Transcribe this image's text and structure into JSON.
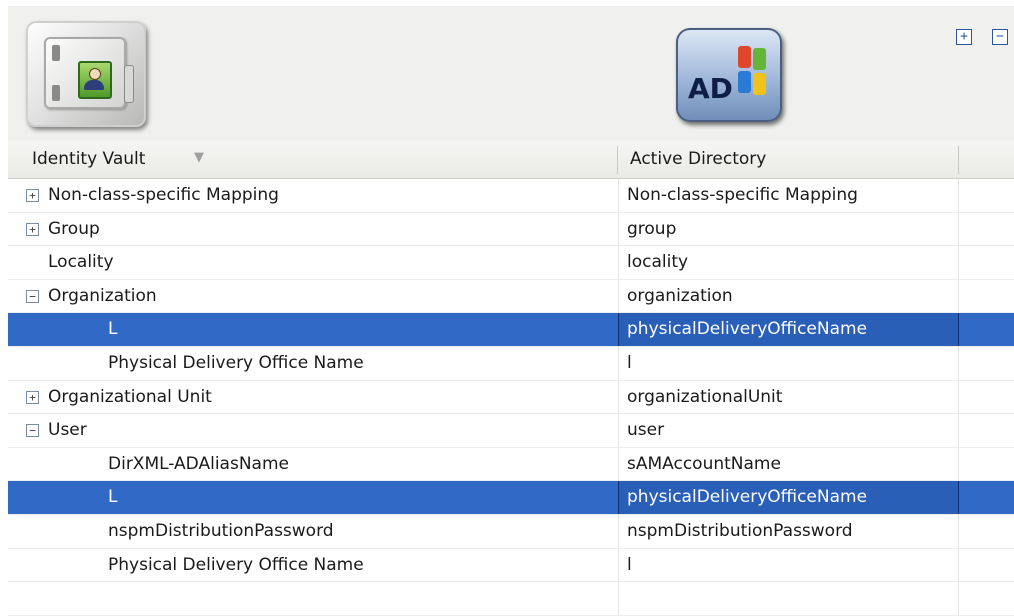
{
  "toolbar": {
    "expand_all_glyph": "+",
    "collapse_all_glyph": "−"
  },
  "icons": {
    "left": "identity-vault-icon",
    "right": "active-directory-icon",
    "right_label": "AD"
  },
  "columns": {
    "left_header": "Identity Vault",
    "right_header": "Active Directory",
    "sort_indicator": "▼"
  },
  "rows": [
    {
      "left": "Non-class-specific Mapping",
      "right": "Non-class-specific Mapping",
      "level": 0,
      "toggle": "+",
      "selected": false
    },
    {
      "left": "Group",
      "right": "group",
      "level": 0,
      "toggle": "+",
      "selected": false
    },
    {
      "left": "Locality",
      "right": "locality",
      "level": 0,
      "toggle": "",
      "selected": false
    },
    {
      "left": "Organization",
      "right": "organization",
      "level": 0,
      "toggle": "−",
      "selected": false
    },
    {
      "left": "L",
      "right": "physicalDeliveryOfficeName",
      "level": 1,
      "toggle": "",
      "selected": true
    },
    {
      "left": "Physical Delivery Office Name",
      "right": "l",
      "level": 1,
      "toggle": "",
      "selected": false
    },
    {
      "left": "Organizational Unit",
      "right": "organizationalUnit",
      "level": 0,
      "toggle": "+",
      "selected": false
    },
    {
      "left": "User",
      "right": "user",
      "level": 0,
      "toggle": "−",
      "selected": false
    },
    {
      "left": "DirXML-ADAliasName",
      "right": "sAMAccountName",
      "level": 1,
      "toggle": "",
      "selected": false
    },
    {
      "left": "L",
      "right": "physicalDeliveryOfficeName",
      "level": 1,
      "toggle": "",
      "selected": true
    },
    {
      "left": "nspmDistributionPassword",
      "right": "nspmDistributionPassword",
      "level": 1,
      "toggle": "",
      "selected": false
    },
    {
      "left": "Physical Delivery Office Name",
      "right": "l",
      "level": 1,
      "toggle": "",
      "selected": false
    },
    {
      "left": "",
      "right": "",
      "level": 0,
      "toggle": "",
      "selected": false
    }
  ],
  "colors": {
    "selection": "#3169c6",
    "header_bg": "#ecece9"
  }
}
